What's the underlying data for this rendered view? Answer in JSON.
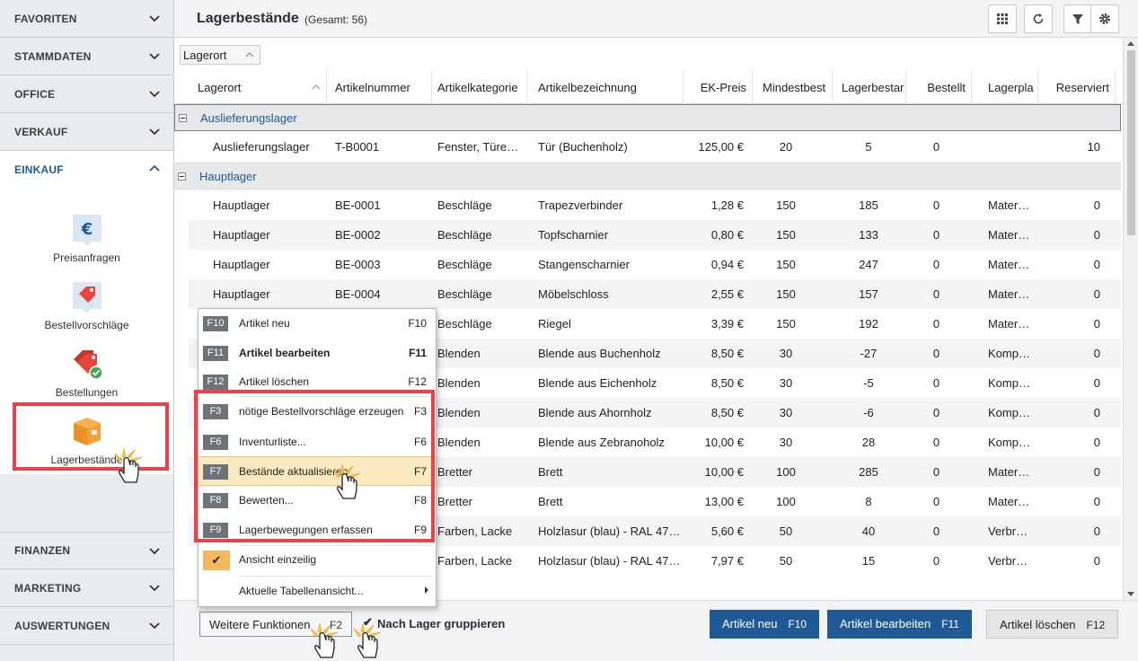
{
  "sidebar": {
    "sections_top": [
      {
        "name": "favoriten",
        "label": "FAVORITEN"
      },
      {
        "name": "stammdaten",
        "label": "STAMMDATEN"
      },
      {
        "name": "office",
        "label": "OFFICE"
      },
      {
        "name": "verkauf",
        "label": "VERKAUF"
      }
    ],
    "active_section": {
      "label": "EINKAUF"
    },
    "shortcuts": [
      {
        "name": "preisanfragen",
        "label": "Preisanfragen",
        "icon": "euro-document-icon"
      },
      {
        "name": "bestellvorschlaege",
        "label": "Bestellvorschläge",
        "icon": "price-tag-icon"
      },
      {
        "name": "bestellungen",
        "label": "Bestellungen",
        "icon": "tag-check-icon"
      },
      {
        "name": "lagerbestaende",
        "label": "Lagerbestände",
        "icon": "box-icon"
      }
    ],
    "sections_bottom": [
      {
        "name": "finanzen",
        "label": "FINANZEN"
      },
      {
        "name": "marketing",
        "label": "MARKETING"
      },
      {
        "name": "auswertungen",
        "label": "AUSWERTUNGEN"
      }
    ]
  },
  "header": {
    "title": "Lagerbestände",
    "count": "(Gesamt: 56)",
    "tools": [
      "grid-layout-icon",
      "refresh-icon",
      "filter-icon",
      "gear-icon"
    ]
  },
  "group_chip": "Lagerort",
  "columns": [
    "Lagerort",
    "Artikelnummer",
    "Artikelkategorie",
    "Artikelbezeichnung",
    "EK-Preis",
    "Mindestbest",
    "Lagerbestar",
    "Bestellt",
    "Lagerpla",
    "Reserviert"
  ],
  "groups": [
    {
      "name": "Auslieferungslager",
      "rows": [
        [
          "Auslieferungslager",
          "T-B0001",
          "Fenster, Türe…",
          "Tür (Buchenholz)",
          "125,00 €",
          "20",
          "5",
          "0",
          "",
          "10"
        ]
      ]
    },
    {
      "name": "Hauptlager",
      "rows": [
        [
          "Hauptlager",
          "BE-0001",
          "Beschläge",
          "Trapezverbinder",
          "1,28 €",
          "150",
          "185",
          "0",
          "Mater…",
          "0"
        ],
        [
          "Hauptlager",
          "BE-0002",
          "Beschläge",
          "Topfscharnier",
          "0,80 €",
          "150",
          "133",
          "0",
          "Mater…",
          "0"
        ],
        [
          "Hauptlager",
          "BE-0003",
          "Beschläge",
          "Stangenscharnier",
          "0,94 €",
          "150",
          "247",
          "0",
          "Mater…",
          "0"
        ],
        [
          "Hauptlager",
          "BE-0004",
          "Beschläge",
          "Möbelschloss",
          "2,55 €",
          "150",
          "157",
          "0",
          "Mater…",
          "0"
        ],
        [
          "",
          "",
          "Beschläge",
          "Riegel",
          "3,39 €",
          "150",
          "192",
          "0",
          "Mater…",
          "0"
        ],
        [
          "",
          "",
          "Blenden",
          "Blende aus Buchenholz",
          "8,50 €",
          "30",
          "-27",
          "0",
          "Komp…",
          "0"
        ],
        [
          "",
          "",
          "Blenden",
          "Blende aus Eichenholz",
          "8,50 €",
          "30",
          "-5",
          "0",
          "Komp…",
          "0"
        ],
        [
          "",
          "",
          "Blenden",
          "Blende aus Ahornholz",
          "8,50 €",
          "30",
          "-6",
          "0",
          "Komp…",
          "0"
        ],
        [
          "",
          "",
          "Blenden",
          "Blende aus Zebranoholz",
          "10,00 €",
          "30",
          "28",
          "0",
          "Komp…",
          "0"
        ],
        [
          "",
          "",
          "Bretter",
          "Brett",
          "10,00 €",
          "100",
          "285",
          "0",
          "Mater…",
          "0"
        ],
        [
          "",
          "",
          "Bretter",
          "Brett",
          "13,00 €",
          "100",
          "8",
          "0",
          "Mater…",
          "0"
        ],
        [
          "",
          "",
          "Farben, Lacke",
          "Holzlasur (blau) - RAL 47…",
          "5,60 €",
          "50",
          "40",
          "0",
          "Verbr…",
          "0"
        ],
        [
          "",
          "",
          "Farben, Lacke",
          "Holzlasur (blau) - RAL 47…",
          "7,97 €",
          "50",
          "15",
          "0",
          "Verbr…",
          "0"
        ]
      ]
    }
  ],
  "context_menu": {
    "items": [
      {
        "badge": "F10",
        "label": "Artikel neu",
        "key": "F10"
      },
      {
        "badge": "F11",
        "label": "Artikel bearbeiten",
        "key": "F11",
        "bold": true
      },
      {
        "badge": "F12",
        "label": "Artikel löschen",
        "key": "F12"
      },
      {
        "badge": "F3",
        "label": "nötige Bestellvorschläge erzeugen",
        "key": "F3"
      },
      {
        "badge": "F6",
        "label": "Inventurliste...",
        "key": "F6"
      },
      {
        "badge": "F7",
        "label": "Bestände aktualisieren",
        "key": "F7",
        "hover": true
      },
      {
        "badge": "F8",
        "label": "Bewerten...",
        "key": "F8"
      },
      {
        "badge": "F9",
        "label": "Lagerbewegungen erfassen",
        "key": "F9"
      }
    ],
    "view_single_line": "Ansicht einzeilig",
    "table_view": "Aktuelle Tabellenansicht..."
  },
  "bottom_bar": {
    "more_label": "Weitere Funktionen",
    "more_key": "F2",
    "group_checkbox_label": "Nach Lager gruppieren",
    "new_label": "Artikel neu",
    "new_key": "F10",
    "edit_label": "Artikel bearbeiten",
    "edit_key": "F11",
    "delete_label": "Artikel löschen",
    "delete_key": "F12"
  },
  "colors": {
    "accent_blue": "#1f5996",
    "highlight_red": "#e8434b",
    "menu_hover": "#fbe9c0",
    "check_orange": "#f3b95f"
  }
}
